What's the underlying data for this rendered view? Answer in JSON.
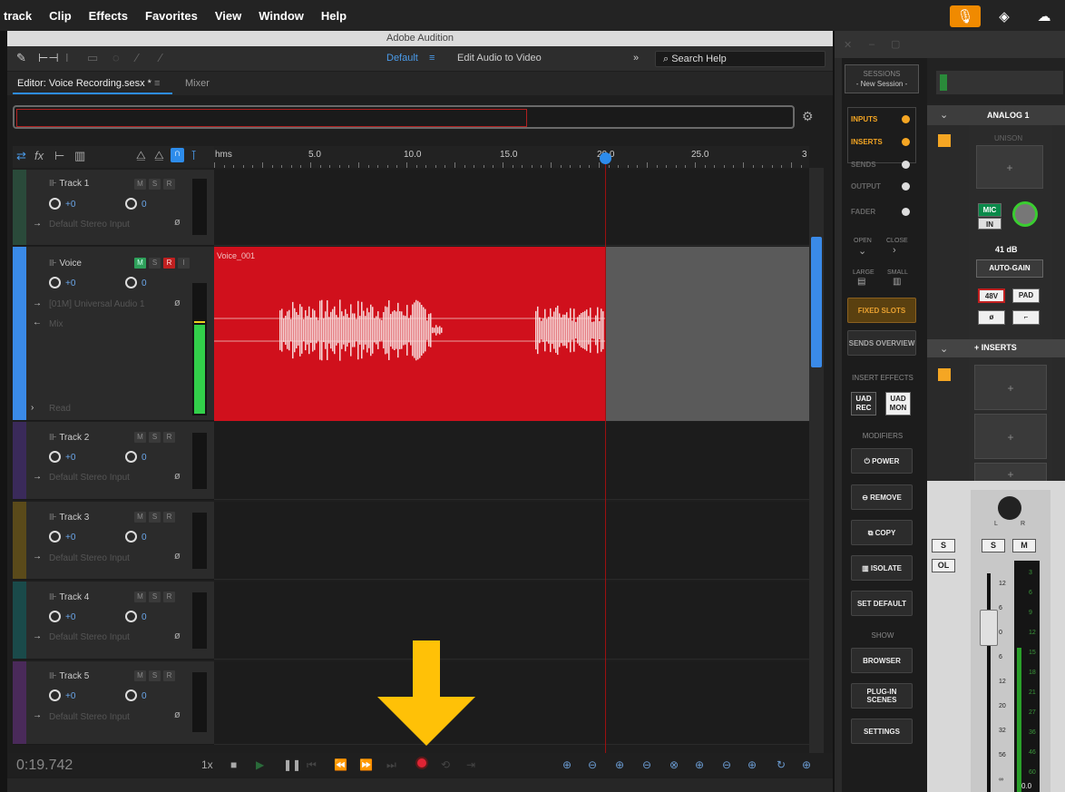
{
  "menubar": {
    "items": [
      "track",
      "Clip",
      "Effects",
      "Favorites",
      "View",
      "Window",
      "Help"
    ]
  },
  "audition": {
    "title": "Adobe Audition",
    "workspace": "Default",
    "workspace_menu": "≡",
    "edit_video": "Edit Audio to Video",
    "overflow": "»",
    "search_placeholder": "Search Help",
    "editor_tab": "Editor: Voice Recording.sesx *",
    "editor_tab_menu": "≡",
    "mixer_tab": "Mixer",
    "ruler": {
      "units": "hms",
      "labels": [
        "5.0",
        "10.0",
        "15.0",
        "20.0",
        "25.0",
        "3"
      ]
    },
    "clip_label": "Voice_001",
    "timecode": "0:19.742",
    "speed": "1x",
    "tracks": [
      {
        "name": "Track 1",
        "vol": "+0",
        "pan": "0",
        "input": "Default Stereo Input",
        "color": "#2a4a3a"
      },
      {
        "name": "Voice",
        "vol": "+0",
        "pan": "0",
        "input": "[01M] Universal Audio 1",
        "output": "Mix",
        "read": "Read",
        "color": "#3a8ae8"
      },
      {
        "name": "Track 2",
        "vol": "+0",
        "pan": "0",
        "input": "Default Stereo Input",
        "color": "#3a2a5a"
      },
      {
        "name": "Track 3",
        "vol": "+0",
        "pan": "0",
        "input": "Default Stereo Input",
        "color": "#5a4a1a"
      },
      {
        "name": "Track 4",
        "vol": "+0",
        "pan": "0",
        "input": "Default Stereo Input",
        "color": "#1a4a4a"
      },
      {
        "name": "Track 5",
        "vol": "+0",
        "pan": "0",
        "input": "Default Stereo Input",
        "color": "#4a2a5a"
      }
    ],
    "track_buttons": {
      "m": "M",
      "s": "S",
      "r": "R",
      "i": "I"
    }
  },
  "console": {
    "sessions_label": "SESSIONS",
    "session_name": "- New Session -",
    "nav": [
      {
        "label": "INPUTS",
        "state": "on"
      },
      {
        "label": "INSERTS",
        "state": "on"
      },
      {
        "label": "SENDS",
        "state": "off"
      },
      {
        "label": "OUTPUT",
        "state": "off"
      },
      {
        "label": "FADER",
        "state": "off"
      }
    ],
    "open": "OPEN",
    "close": "CLOSE",
    "large": "LARGE",
    "small": "SMALL",
    "fixed_slots": "FIXED SLOTS",
    "sends_overview": "SENDS OVERVIEW",
    "insert_effects": "INSERT EFFECTS",
    "uad_rec": "UAD REC",
    "uad_mon": "UAD MON",
    "modifiers": "MODIFIERS",
    "power": "POWER",
    "remove": "REMOVE",
    "copy": "COPY",
    "isolate": "ISOLATE",
    "set_default": "SET DEFAULT",
    "show": "SHOW",
    "browser": "BROWSER",
    "plugin_scenes": "PLUG-IN SCENES",
    "settings": "SETTINGS",
    "channel": "ANALOG 1",
    "unison": "UNISON",
    "mic": "MIC",
    "in": "IN",
    "gain": "41 dB",
    "auto_gain": "AUTO-GAIN",
    "v48": "48V",
    "pad": "PAD",
    "phase": "ø",
    "inserts": "INSERTS",
    "s": "S",
    "m": "M",
    "ol": "OL",
    "pan_l": "L",
    "pan_r": "R",
    "fader_scale": [
      "12",
      "6",
      "0",
      "6",
      "12",
      "20",
      "32",
      "56",
      "∞"
    ],
    "meter_scale": [
      "3",
      "6",
      "9",
      "12",
      "15",
      "18",
      "21",
      "27",
      "36",
      "46",
      "60"
    ],
    "bottom_value": "0.0",
    "accent": "#f5a623"
  }
}
